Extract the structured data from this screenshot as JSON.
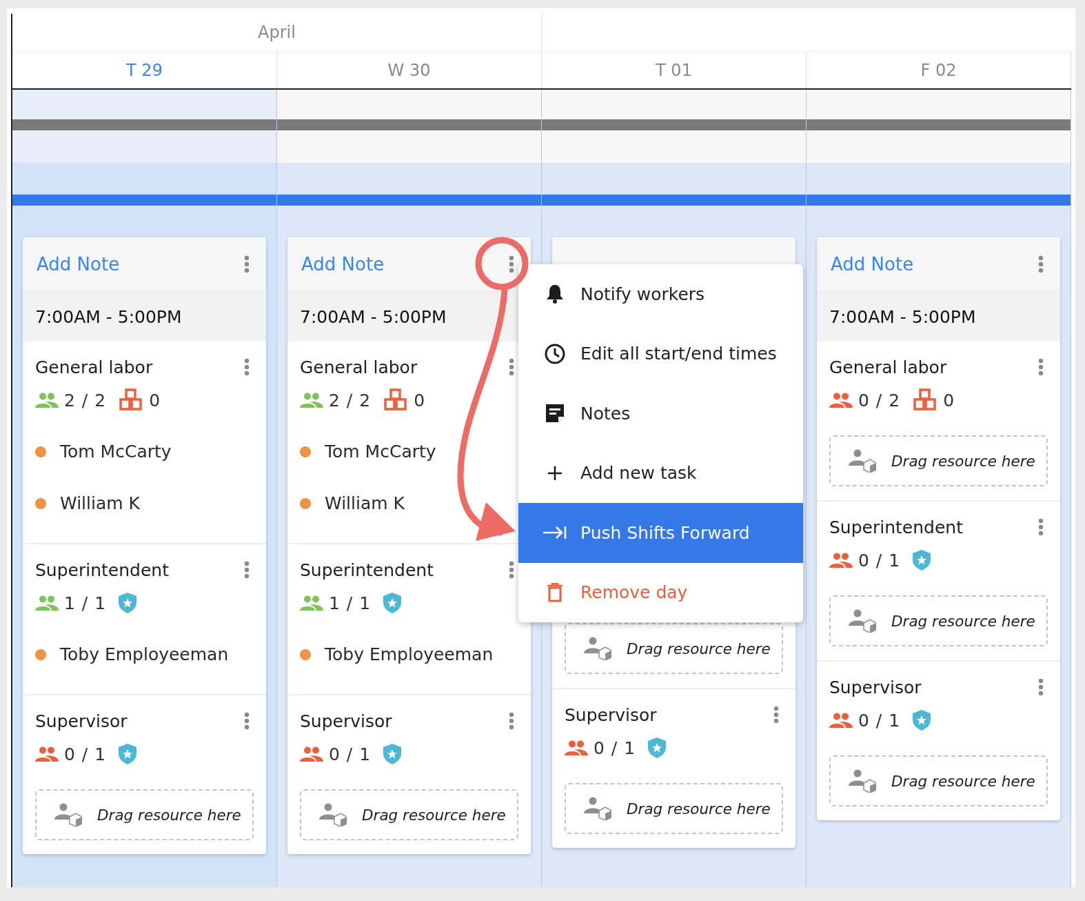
{
  "month": {
    "label": "April"
  },
  "days": [
    {
      "label": "T 29",
      "selected": true
    },
    {
      "label": "W 30",
      "selected": false
    },
    {
      "label": "T 01",
      "selected": false
    },
    {
      "label": "F 02",
      "selected": false
    }
  ],
  "columns": [
    {
      "note": "Add Note",
      "shift": "7:00AM - 5:00PM",
      "sections": [
        {
          "title": "General labor",
          "count": "2 / 2",
          "complete": true,
          "badge": {
            "kind": "equipment",
            "count": "0"
          },
          "workers": [
            {
              "name": "Tom McCarty",
              "color": "#ec9444"
            },
            {
              "name": "William K",
              "color": "#ec9444"
            }
          ]
        },
        {
          "title": "Superintendent",
          "count": "1 / 1",
          "complete": true,
          "badge": {
            "kind": "certified"
          },
          "workers": [
            {
              "name": "Toby Employeeman",
              "color": "#ec9444"
            }
          ]
        },
        {
          "title": "Supervisor",
          "count": "0 / 1",
          "complete": false,
          "badge": {
            "kind": "certified"
          },
          "drop_zone": "Drag resource here"
        }
      ]
    },
    {
      "note": "Add Note",
      "shift": "7:00AM - 5:00PM",
      "sections": [
        {
          "title": "General labor",
          "count": "2 / 2",
          "complete": true,
          "badge": {
            "kind": "equipment",
            "count": "0"
          },
          "workers": [
            {
              "name": "Tom McCarty",
              "color": "#ec9444"
            },
            {
              "name": "William K",
              "color": "#ec9444"
            }
          ]
        },
        {
          "title": "Superintendent",
          "count": "1 / 1",
          "complete": true,
          "badge": {
            "kind": "certified"
          },
          "workers": [
            {
              "name": "Toby Employeeman",
              "color": "#ec9444"
            }
          ]
        },
        {
          "title": "Supervisor",
          "count": "0 / 1",
          "complete": false,
          "badge": {
            "kind": "certified"
          },
          "drop_zone": "Drag resource here"
        }
      ]
    },
    {
      "sections": [
        {
          "drop_zone": "Drag resource here"
        },
        {
          "title": "Supervisor",
          "count": "0 / 1",
          "complete": false,
          "badge": {
            "kind": "certified"
          },
          "drop_zone": "Drag resource here"
        }
      ]
    },
    {
      "note": "Add Note",
      "shift": "7:00AM - 5:00PM",
      "sections": [
        {
          "title": "General labor",
          "count": "0 / 2",
          "complete": false,
          "badge": {
            "kind": "equipment",
            "count": "0"
          },
          "drop_zone": "Drag resource here"
        },
        {
          "title": "Superintendent",
          "count": "0 / 1",
          "complete": false,
          "badge": {
            "kind": "certified"
          },
          "drop_zone": "Drag resource here"
        },
        {
          "title": "Supervisor",
          "count": "0 / 1",
          "complete": false,
          "badge": {
            "kind": "certified"
          },
          "drop_zone": "Drag resource here"
        }
      ]
    }
  ],
  "context_menu": {
    "items": [
      {
        "label": "Notify workers",
        "kind": "normal",
        "selected": false
      },
      {
        "label": "Edit all start/end times",
        "kind": "normal",
        "selected": false
      },
      {
        "label": "Notes",
        "kind": "normal",
        "selected": false
      },
      {
        "label": "Add new task",
        "kind": "normal",
        "selected": false
      },
      {
        "label": "Push Shifts Forward",
        "kind": "normal",
        "selected": true
      },
      {
        "label": "Remove day",
        "kind": "danger",
        "selected": false
      }
    ]
  }
}
